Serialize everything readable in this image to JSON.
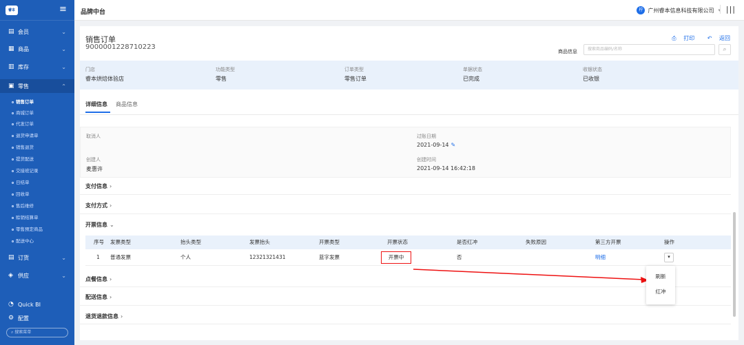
{
  "app": {
    "title": "品牌中台",
    "company": "广州睿本信息科技有限公司",
    "logo_text": "睿本"
  },
  "sidebar": {
    "menu": [
      {
        "label": "会员",
        "icon": "member-card-icon"
      },
      {
        "label": "商品",
        "icon": "grid-icon"
      },
      {
        "label": "库存",
        "icon": "warehouse-icon"
      },
      {
        "label": "零售",
        "icon": "retail-icon"
      },
      {
        "label": "订货",
        "icon": "order-icon"
      },
      {
        "label": "供应",
        "icon": "supply-icon"
      },
      {
        "label": "Quick BI",
        "icon": "quickbi-icon"
      },
      {
        "label": "配置",
        "icon": "gear-icon"
      }
    ],
    "sub_items": [
      "销售订单",
      "商城订单",
      "代发订单",
      "退货申请单",
      "销售退货",
      "提货配送",
      "交接班记录",
      "日结单",
      "回收单",
      "售后维修",
      "赊销结算单",
      "零售预定商品",
      "配送中心"
    ],
    "active_sub": "销售订单",
    "search_placeholder": "搜索菜单"
  },
  "page": {
    "title": "销售订单",
    "order_no": "9000001228710223",
    "print_label": "打印",
    "back_label": "返回",
    "product_info_label": "商品信息",
    "product_search_placeholder": "搜索商品编码/名称"
  },
  "summary": [
    {
      "key": "门店",
      "value": "睿本烘焙体验店"
    },
    {
      "key": "功能类型",
      "value": "零售"
    },
    {
      "key": "订单类型",
      "value": "零售订单"
    },
    {
      "key": "单据状态",
      "value": "已完成"
    },
    {
      "key": "收银状态",
      "value": "已收银"
    }
  ],
  "tabs": [
    "详细信息",
    "商品信息"
  ],
  "details": {
    "cancel_by_label": "取消人",
    "posting_date_label": "过账日期",
    "posting_date": "2021-09-14",
    "creator_label": "创建人",
    "creator": "麦惠许",
    "created_time_label": "创建时间",
    "created_time": "2021-09-14 16:42:18"
  },
  "sections": {
    "payment_info": "支付信息",
    "payment_method": "支付方式",
    "invoice_info": "开票信息",
    "tasting_info": "点餐信息",
    "delivery_info": "配送信息",
    "refund_info": "退货退款信息"
  },
  "invoice_table": {
    "headers": [
      "序号",
      "发票类型",
      "抬头类型",
      "发票抬头",
      "开票类型",
      "开票状态",
      "是否红冲",
      "失败原因",
      "第三方开票",
      "操作"
    ],
    "row": {
      "no": "1",
      "invoice_type": "普通发票",
      "title_type": "个人",
      "title": "12321321431",
      "issue_type": "蓝字发票",
      "status": "开票中",
      "red_flush": "否",
      "reason": "",
      "third_party": "明细"
    }
  },
  "dropdown": {
    "refresh": "刷新",
    "red_flush": "红冲"
  },
  "colors": {
    "sidebar": "#1e5eb8",
    "accent": "#1e6ee8",
    "highlight": "#e11111"
  }
}
